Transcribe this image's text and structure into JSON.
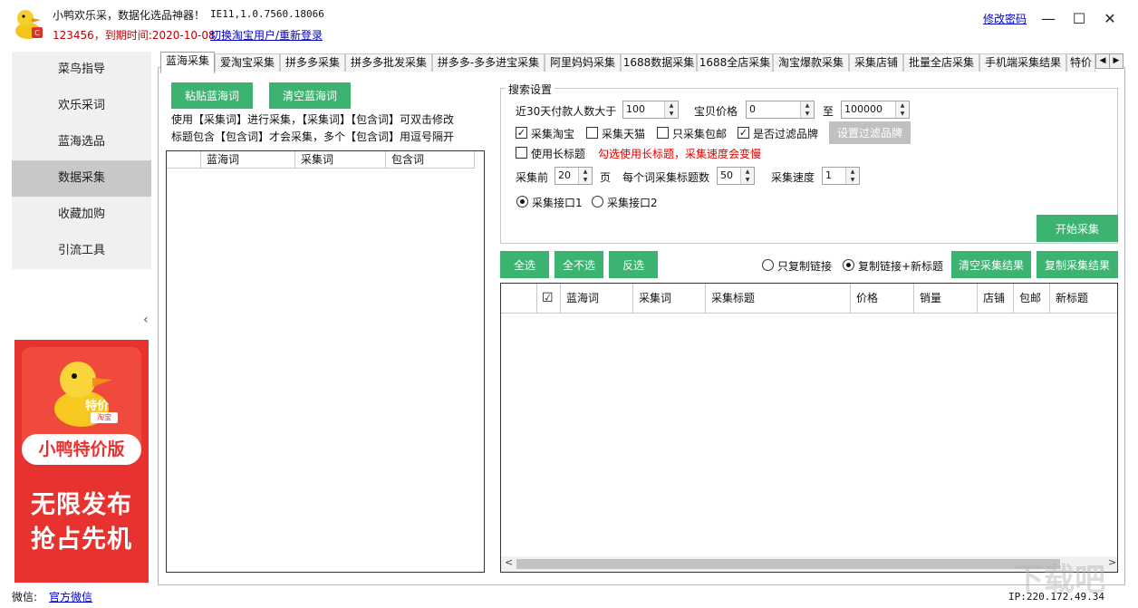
{
  "titlebar": {
    "app_title": "小鸭欢乐采，数据化选品神器！",
    "version": "IE11,1.0.7560.18066",
    "user_info": "123456，到期时间:2020-10-08",
    "switch_user": "切换淘宝用户/重新登录",
    "change_password": "修改密码",
    "minimize_glyph": "—",
    "maximize_glyph": "☐",
    "close_glyph": "✕"
  },
  "sidebar": {
    "items": [
      {
        "label": "菜鸟指导"
      },
      {
        "label": "欢乐采词"
      },
      {
        "label": "蓝海选品"
      },
      {
        "label": "数据采集"
      },
      {
        "label": "收藏加购"
      },
      {
        "label": "引流工具"
      }
    ],
    "active_index": 3,
    "collapse_glyph": "‹"
  },
  "promo": {
    "badge": "特价",
    "badge_sub": "淘宝",
    "title": "小鸭特价版",
    "line1": "无限发布",
    "line2": "抢占先机"
  },
  "footer": {
    "wechat_label": "微信:",
    "wechat_link": "官方微信",
    "ip": "IP:220.172.49.34"
  },
  "tabs": [
    {
      "label": "蓝海采集"
    },
    {
      "label": "爱淘宝采集"
    },
    {
      "label": "拼多多采集"
    },
    {
      "label": "拼多多批发采集"
    },
    {
      "label": "拼多多-多多进宝采集"
    },
    {
      "label": "阿里妈妈采集"
    },
    {
      "label": "1688数据采集"
    },
    {
      "label": "1688全店采集"
    },
    {
      "label": "淘宝爆款采集"
    },
    {
      "label": "采集店铺"
    },
    {
      "label": "批量全店采集"
    },
    {
      "label": "手机端采集结果"
    },
    {
      "label": "特价"
    }
  ],
  "tab_scroll": {
    "left": "◀",
    "right": "▶"
  },
  "left_panel": {
    "paste_button": "粘贴蓝海词",
    "clear_button": "清空蓝海词",
    "hint_line1": "使用【采集词】进行采集，【采集词】【包含词】可双击修改",
    "hint_line2": "标题包含【包含词】才会采集，多个【包含词】用逗号隔开",
    "columns": [
      "蓝海词",
      "采集词",
      "包含词"
    ]
  },
  "settings": {
    "legend": "搜索设置",
    "buyers_label": "近30天付款人数大于",
    "buyers_value": "100",
    "price_label": "宝贝价格",
    "price_min": "0",
    "price_to": "至",
    "price_max": "100000",
    "cb_taobao": {
      "label": "采集淘宝",
      "checked": true
    },
    "cb_tmall": {
      "label": "采集天猫",
      "checked": false
    },
    "cb_free_ship": {
      "label": "只采集包邮",
      "checked": false
    },
    "cb_filter_brand": {
      "label": "是否过滤品牌",
      "checked": true
    },
    "brand_button": "设置过滤品牌",
    "cb_long_title": {
      "label": "使用长标题",
      "checked": false
    },
    "warning": "勾选使用长标题，采集速度会变慢",
    "pages_label": "采集前",
    "pages_value": "20",
    "pages_unit": "页",
    "per_word_label": "每个词采集标题数",
    "per_word_value": "50",
    "speed_label": "采集速度",
    "speed_value": "1",
    "api1": {
      "label": "采集接口1",
      "selected": true
    },
    "api2": {
      "label": "采集接口2",
      "selected": false
    },
    "start_button": "开始采集"
  },
  "results": {
    "select_all": "全选",
    "select_none": "全不选",
    "invert": "反选",
    "copy_link_only": {
      "label": "只复制链接",
      "selected": false
    },
    "copy_link_title": {
      "label": "复制链接+新标题",
      "selected": true
    },
    "clear_button": "清空采集结果",
    "copy_button": "复制采集结果",
    "header_check": "☑",
    "columns": [
      "蓝海词",
      "采集词",
      "采集标题",
      "价格",
      "销量",
      "店铺",
      "包邮",
      "新标题"
    ],
    "scroll_left": "<",
    "scroll_right": ">"
  },
  "watermark": "下载吧"
}
